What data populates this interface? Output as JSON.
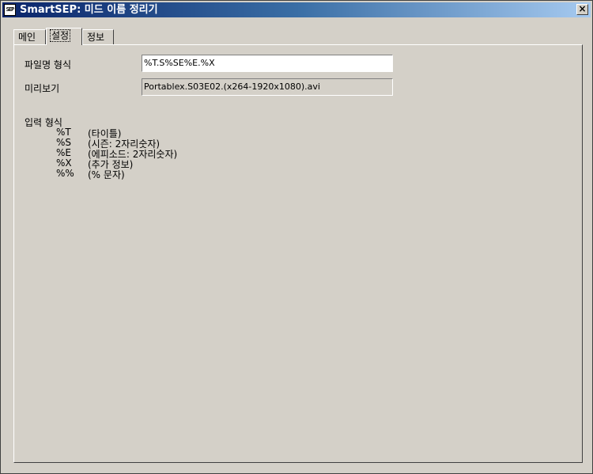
{
  "window": {
    "title": "SmartSEP: 미드 이름 정리기",
    "icon_text": "SEP",
    "close_glyph": "×"
  },
  "tabs": [
    {
      "label": "메인",
      "active": false
    },
    {
      "label": "설정",
      "active": true
    },
    {
      "label": "정보",
      "active": false
    }
  ],
  "settings": {
    "filename_format_label": "파일명 형식",
    "filename_format_value": "%T.S%SE%E.%X",
    "preview_label": "미리보기",
    "preview_value": "Portablex.S03E02.(x264-1920x1080).avi",
    "input_format_heading": "입력 형식",
    "format_codes": [
      {
        "code": "%T",
        "desc": "(타이틀)"
      },
      {
        "code": "%S",
        "desc": "(시즌: 2자리숫자)"
      },
      {
        "code": "%E",
        "desc": "(에피소드: 2자리숫자)"
      },
      {
        "code": "%X",
        "desc": "(추가 정보)"
      },
      {
        "code": "%%",
        "desc": "(% 문자)"
      }
    ]
  }
}
